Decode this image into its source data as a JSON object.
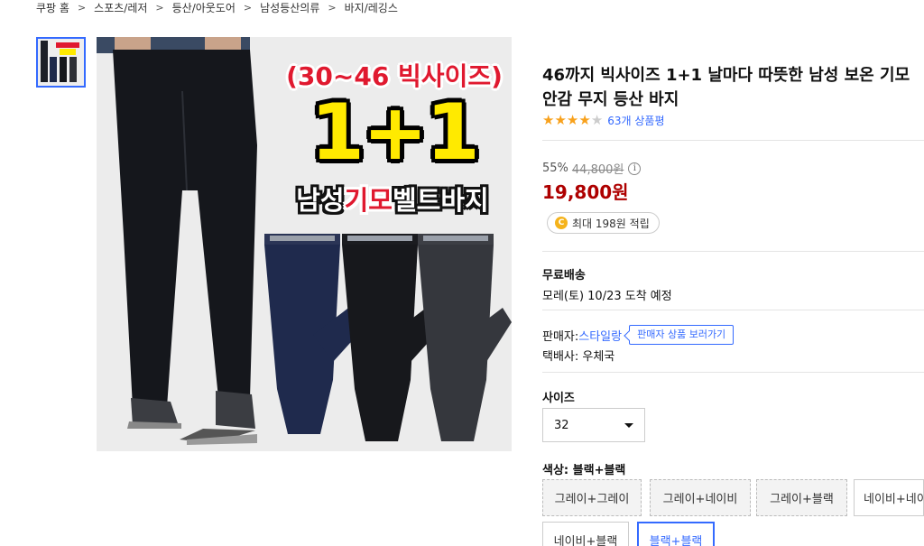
{
  "breadcrumb": [
    "쿠팡 홈",
    "스포츠/레저",
    "등산/아웃도어",
    "남성등산의류",
    "바지/레깅스"
  ],
  "breadcrumb_sep": ">",
  "image": {
    "banner_range": "(30~46 빅사이즈)",
    "banner_big": "1+1",
    "banner_sub_a": "남성",
    "banner_sub_hl": "기모",
    "banner_sub_b": "벨트바지"
  },
  "product": {
    "title": "46까지 빅사이즈 1+1 날마다 따뜻한 남성 보온 기모안감 무지 등산 바지",
    "rating": 4,
    "rating_max": 5,
    "review_count_label": "63개 상품평",
    "discount": "55%",
    "original_price": "44,800원",
    "sale_price": "19,800원",
    "reward_text": "최대 198원 적립"
  },
  "shipping": {
    "label": "무료배송",
    "eta": "모레(토) 10/23 도착 예정"
  },
  "seller": {
    "label": "판매자: ",
    "name": "스타일랑",
    "button": "판매자 상품 보러가기",
    "courier": "택배사: 우체국"
  },
  "size": {
    "label": "사이즈",
    "selected": "32"
  },
  "color": {
    "label": "색상: 블랙+블랙",
    "options": [
      "그레이+그레이",
      "그레이+네이비",
      "그레이+블랙",
      "네이비+네이비",
      "네이비+블랙",
      "블랙+블랙"
    ],
    "selected_index": 5
  },
  "colors": {
    "accent": "#346aff",
    "price": "#ae0000",
    "star": "#f8a11c"
  }
}
